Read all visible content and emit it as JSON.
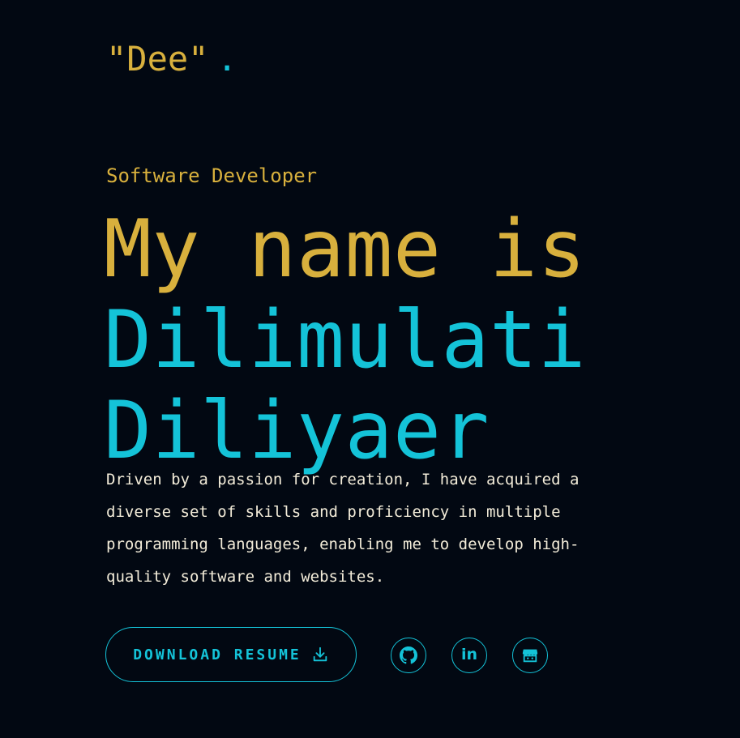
{
  "header": {
    "logo_text": "\"Dee\"",
    "logo_dot": "."
  },
  "hero": {
    "role": "Software Developer",
    "heading_line1": "My name is",
    "heading_line2": "Dilimulati",
    "heading_line3": "Diliyaer",
    "bio": "Driven by a passion for creation, I have acquired a diverse set of skills and proficiency in multiple programming languages, enabling me to develop high-quality software and websites."
  },
  "actions": {
    "resume_label": "DOWNLOAD RESUME",
    "resume_icon": "download-icon",
    "socials": [
      {
        "icon": "github-icon"
      },
      {
        "icon": "linkedin-icon",
        "glyph": "in"
      },
      {
        "icon": "store-icon"
      }
    ]
  },
  "colors": {
    "background": "#020812",
    "accent_gold": "#d8b03d",
    "accent_cyan": "#14c3d8",
    "text": "#f3ecd9"
  }
}
